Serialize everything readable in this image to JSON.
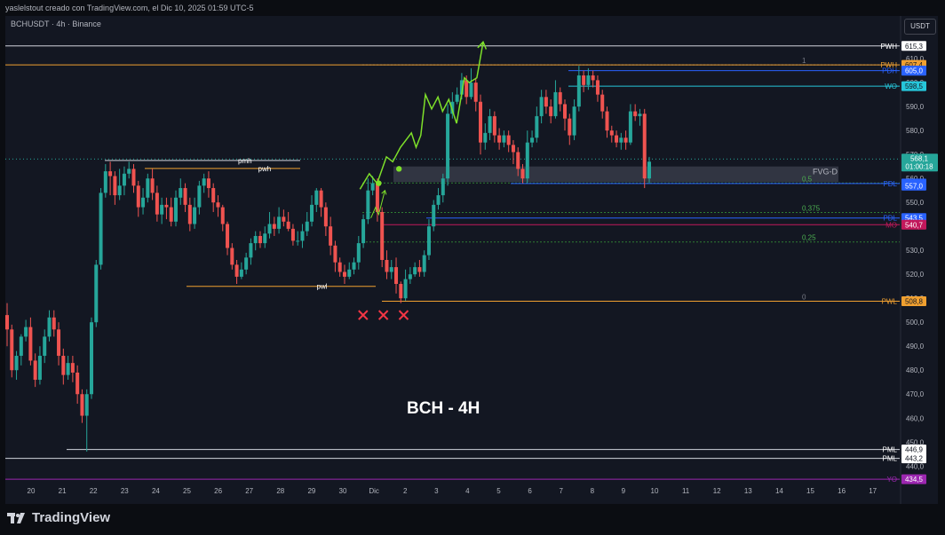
{
  "attribution": "yaslelstout creado con TradingView.com, el Dic 10, 2025 01:59 UTC-5",
  "symbol": "BCHUSDT · 4h · Binance",
  "currency": "USDT",
  "brand": "TradingView",
  "annotation_title": "BCH - 4H",
  "colors": {
    "background": "#131722",
    "up": "#26a69a",
    "down": "#ef5350",
    "projection": "#7ee02a",
    "invalid": "#f23645",
    "level_white": "#d1d4dc",
    "level_orange": "#f0a030",
    "level_blue": "#2962ff",
    "level_cyan": "#26c6da",
    "level_red": "#c2185b",
    "level_purple": "#9c27b0"
  },
  "chart_data": {
    "type": "candlestick",
    "ylim": [
      429,
      618
    ],
    "y_ticks": [
      "610,0",
      "600,0",
      "590,0",
      "580,0",
      "570,0",
      "560,0",
      "550,0",
      "540,0",
      "530,0",
      "520,0",
      "510,0",
      "500,0",
      "490,0",
      "480,0",
      "470,0",
      "460,0",
      "450,0",
      "440,0"
    ],
    "x_ticks": [
      "20",
      "21",
      "22",
      "23",
      "24",
      "25",
      "26",
      "27",
      "28",
      "29",
      "30",
      "Dic",
      "2",
      "3",
      "4",
      "5",
      "6",
      "7",
      "8",
      "9",
      "10",
      "11",
      "12",
      "13",
      "14",
      "15",
      "16",
      "17"
    ],
    "levels": [
      {
        "label": "PWH",
        "value": 615.3,
        "price_label": "615,3",
        "color": "#d1d4dc",
        "style": "solid"
      },
      {
        "label": "PWH",
        "value": 607.4,
        "price_label": "607,4",
        "color": "#f0a030",
        "style": "solid"
      },
      {
        "label": "PDH",
        "value": 605.0,
        "price_label": "605,0",
        "color": "#2962ff",
        "style": "solid"
      },
      {
        "label": "WO",
        "value": 598.5,
        "price_label": "598,5",
        "color": "#26c6da",
        "style": "solid"
      },
      {
        "label": "PDL",
        "value": 557.9,
        "price_label": "557,9",
        "color": "#2962ff",
        "style": "solid"
      },
      {
        "label": "PDL",
        "value": 543.5,
        "price_label": "543,5",
        "color": "#2962ff",
        "style": "solid"
      },
      {
        "label": "MO",
        "value": 540.7,
        "price_label": "540,7",
        "color": "#c2185b",
        "style": "solid"
      },
      {
        "label": "PWL",
        "value": 508.8,
        "price_label": "508,8",
        "color": "#f0a030",
        "style": "solid"
      },
      {
        "label": "PML",
        "value": 446.9,
        "price_label": "446,9",
        "color": "#d1d4dc",
        "style": "solid"
      },
      {
        "label": "PML",
        "value": 443.2,
        "price_label": "443,2",
        "color": "#d1d4dc",
        "style": "solid"
      },
      {
        "label": "YO",
        "value": 434.5,
        "price_label": "434,5",
        "color": "#9c27b0",
        "style": "solid"
      }
    ],
    "extra_price_labels": [
      {
        "value": 605.0,
        "text": "605,0"
      },
      {
        "value": 557.0,
        "text": "557,0"
      }
    ],
    "current_price": {
      "value": 568.1,
      "text": "568,1",
      "countdown": "01:00:18"
    },
    "weekly_labels": [
      {
        "label": "pmh",
        "value": 567.5
      },
      {
        "label": "pwh",
        "value": 564.2
      },
      {
        "label": "pwl",
        "value": 515.0
      }
    ],
    "fvg": {
      "label": "FVG-D",
      "top": 565.0,
      "bottom": 558.5
    },
    "fibs": [
      {
        "label": "1",
        "value": 607.4
      },
      {
        "label": "0,5",
        "value": 558.1
      },
      {
        "label": "0,375",
        "value": 545.8
      },
      {
        "label": "0,25",
        "value": 533.5
      },
      {
        "label": "0",
        "value": 508.8
      }
    ],
    "candles": [
      [
        503,
        497,
        508,
        490
      ],
      [
        497,
        480,
        499,
        477
      ],
      [
        480,
        486,
        488,
        476
      ],
      [
        486,
        494,
        495,
        482
      ],
      [
        494,
        498,
        501,
        492
      ],
      [
        498,
        484,
        502,
        482
      ],
      [
        484,
        476,
        487,
        473
      ],
      [
        476,
        486,
        490,
        474
      ],
      [
        486,
        494,
        497,
        483
      ],
      [
        494,
        502,
        505,
        492
      ],
      [
        502,
        497,
        505,
        494
      ],
      [
        497,
        486,
        500,
        482
      ],
      [
        486,
        478,
        489,
        474
      ],
      [
        478,
        483,
        486,
        476
      ],
      [
        483,
        479,
        486,
        475
      ],
      [
        479,
        470,
        482,
        466
      ],
      [
        470,
        461,
        472,
        458
      ],
      [
        461,
        470,
        472,
        446
      ],
      [
        470,
        500,
        502,
        468
      ],
      [
        500,
        524,
        526,
        498
      ],
      [
        524,
        554,
        556,
        522
      ],
      [
        554,
        563,
        566,
        552
      ],
      [
        563,
        561,
        567,
        553
      ],
      [
        561,
        553,
        563,
        549
      ],
      [
        553,
        557,
        564,
        551
      ],
      [
        557,
        562,
        565,
        553
      ],
      [
        562,
        564,
        567,
        560
      ],
      [
        564,
        557,
        566,
        554
      ],
      [
        557,
        548,
        559,
        544
      ],
      [
        548,
        552,
        556,
        545
      ],
      [
        552,
        560,
        562,
        550
      ],
      [
        560,
        554,
        564,
        551
      ],
      [
        554,
        545,
        557,
        542
      ],
      [
        545,
        549,
        552,
        541
      ],
      [
        549,
        548,
        552,
        543
      ],
      [
        548,
        542,
        552,
        540
      ],
      [
        542,
        552,
        555,
        540
      ],
      [
        552,
        556,
        560,
        549
      ],
      [
        556,
        549,
        558,
        546
      ],
      [
        549,
        541,
        552,
        538
      ],
      [
        541,
        548,
        552,
        539
      ],
      [
        548,
        557,
        559,
        545
      ],
      [
        557,
        560,
        562,
        554
      ],
      [
        560,
        556,
        563,
        552
      ],
      [
        556,
        550,
        558,
        546
      ],
      [
        550,
        548,
        553,
        544
      ],
      [
        548,
        541,
        549,
        538
      ],
      [
        541,
        531,
        542,
        528
      ],
      [
        531,
        524,
        533,
        522
      ],
      [
        524,
        519,
        526,
        516
      ],
      [
        519,
        522,
        525,
        518
      ],
      [
        522,
        527,
        529,
        520
      ],
      [
        527,
        533,
        535,
        524
      ],
      [
        533,
        536,
        538,
        530
      ],
      [
        536,
        533,
        538,
        531
      ],
      [
        533,
        537,
        540,
        531
      ],
      [
        537,
        541,
        546,
        535
      ],
      [
        541,
        539,
        544,
        536
      ],
      [
        539,
        544,
        548,
        537
      ],
      [
        544,
        542,
        547,
        540
      ],
      [
        542,
        539,
        546,
        538
      ],
      [
        539,
        534,
        541,
        532
      ],
      [
        534,
        534,
        538,
        532
      ],
      [
        534,
        538,
        541,
        531
      ],
      [
        538,
        542,
        546,
        536
      ],
      [
        542,
        549,
        553,
        540
      ],
      [
        549,
        555,
        556,
        546
      ],
      [
        555,
        548,
        556,
        544
      ],
      [
        548,
        540,
        550,
        536
      ],
      [
        540,
        532,
        544,
        528
      ],
      [
        532,
        525,
        534,
        521
      ],
      [
        525,
        521,
        527,
        519
      ],
      [
        521,
        519,
        524,
        516
      ],
      [
        519,
        522,
        525,
        518
      ],
      [
        522,
        525,
        527,
        520
      ],
      [
        525,
        533,
        536,
        522
      ],
      [
        533,
        543,
        545,
        531
      ],
      [
        543,
        555,
        560,
        541
      ],
      [
        555,
        558,
        561,
        553
      ],
      [
        558,
        546,
        560,
        542
      ],
      [
        546,
        526,
        548,
        523
      ],
      [
        526,
        521,
        530,
        518
      ],
      [
        521,
        523,
        526,
        518
      ],
      [
        523,
        516,
        527,
        512
      ],
      [
        516,
        510,
        517,
        508
      ],
      [
        510,
        518,
        522,
        509
      ],
      [
        518,
        520,
        523,
        516
      ],
      [
        520,
        523,
        525,
        519
      ],
      [
        523,
        521,
        526,
        519
      ],
      [
        521,
        528,
        530,
        519
      ],
      [
        528,
        540,
        543,
        526
      ],
      [
        540,
        549,
        551,
        538
      ],
      [
        549,
        553,
        556,
        547
      ],
      [
        553,
        560,
        562,
        550
      ],
      [
        560,
        587,
        591,
        557
      ],
      [
        587,
        592,
        596,
        585
      ],
      [
        592,
        595,
        598,
        591
      ],
      [
        595,
        601,
        604,
        593
      ],
      [
        601,
        594,
        603,
        591
      ],
      [
        594,
        600,
        606,
        593
      ],
      [
        600,
        592,
        602,
        588
      ],
      [
        592,
        575,
        595,
        570
      ],
      [
        575,
        579,
        583,
        572
      ],
      [
        579,
        586,
        589,
        576
      ],
      [
        586,
        578,
        588,
        575
      ],
      [
        578,
        575,
        581,
        572
      ],
      [
        575,
        578,
        580,
        573
      ],
      [
        578,
        574,
        580,
        571
      ],
      [
        574,
        571,
        576,
        566
      ],
      [
        571,
        564,
        573,
        561
      ],
      [
        564,
        560,
        566,
        558
      ],
      [
        560,
        575,
        580,
        558
      ],
      [
        575,
        577,
        580,
        573
      ],
      [
        577,
        586,
        590,
        575
      ],
      [
        586,
        594,
        597,
        583
      ],
      [
        594,
        590,
        597,
        587
      ],
      [
        590,
        586,
        593,
        583
      ],
      [
        586,
        596,
        601,
        585
      ],
      [
        596,
        591,
        598,
        588
      ],
      [
        591,
        585,
        593,
        580
      ],
      [
        585,
        578,
        587,
        574
      ],
      [
        578,
        590,
        593,
        576
      ],
      [
        590,
        603,
        607,
        588
      ],
      [
        603,
        599,
        605,
        596
      ],
      [
        599,
        603,
        606,
        597
      ],
      [
        603,
        601,
        605,
        598
      ],
      [
        601,
        595,
        603,
        592
      ],
      [
        595,
        588,
        597,
        585
      ],
      [
        588,
        580,
        590,
        577
      ],
      [
        580,
        578,
        582,
        575
      ],
      [
        578,
        575,
        580,
        573
      ],
      [
        575,
        577,
        579,
        572
      ],
      [
        577,
        575,
        580,
        572
      ],
      [
        575,
        588,
        591,
        574
      ],
      [
        588,
        586,
        591,
        584
      ],
      [
        586,
        587,
        589,
        582
      ],
      [
        587,
        560,
        589,
        556
      ],
      [
        560,
        567,
        569,
        558
      ]
    ],
    "projections": [
      {
        "name": "main",
        "points": [
          [
            10.55,
            555.5
          ],
          [
            10.85,
            562
          ],
          [
            11.1,
            558
          ],
          [
            11.4,
            569
          ],
          [
            11.6,
            567
          ],
          [
            11.85,
            573
          ],
          [
            12.2,
            579
          ],
          [
            12.35,
            573
          ],
          [
            12.5,
            578
          ],
          [
            12.65,
            595
          ],
          [
            12.85,
            589
          ],
          [
            13.05,
            594
          ],
          [
            13.2,
            588
          ],
          [
            13.4,
            593
          ],
          [
            13.65,
            583
          ],
          [
            13.9,
            602
          ],
          [
            14.05,
            600
          ],
          [
            14.3,
            602
          ],
          [
            14.5,
            617
          ]
        ]
      },
      {
        "name": "alt",
        "points": [
          [
            10.9,
            543.5
          ],
          [
            11.05,
            548
          ],
          [
            11.15,
            545
          ],
          [
            11.35,
            555
          ]
        ]
      }
    ],
    "projection_dots": [
      [
        11.15,
        558
      ],
      [
        11.8,
        564
      ]
    ],
    "invalidation_marks": [
      [
        10.65,
        503
      ],
      [
        11.3,
        503
      ],
      [
        11.95,
        503
      ]
    ]
  }
}
